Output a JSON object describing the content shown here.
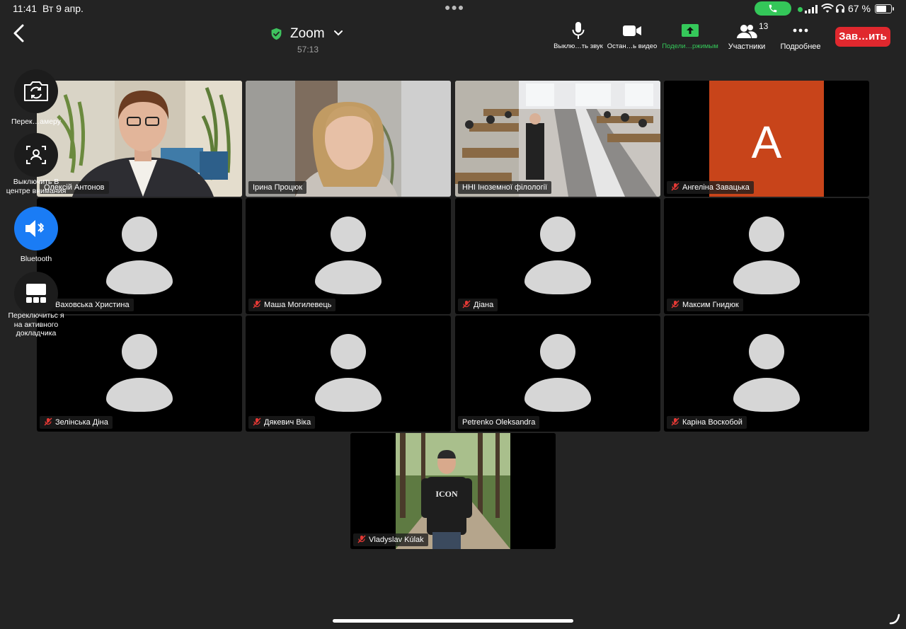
{
  "status_bar": {
    "time": "11:41",
    "date": "Вт 9 апр.",
    "battery_percent": "67 %"
  },
  "meeting": {
    "title": "Zoom",
    "timer": "57:13"
  },
  "toolbar": {
    "mute_label": "Выклю…ть звук",
    "video_label": "Остан…ь видео",
    "share_label": "Подели…ржимым",
    "participants_label": "Участники",
    "participants_count": "13",
    "more_label": "Подробнее",
    "end_label": "Зав…ить"
  },
  "side_controls": [
    {
      "label": "Перек…амеру"
    },
    {
      "label": "Выключить В центре внимания"
    },
    {
      "label": "Bluetooth"
    },
    {
      "label": "Переключитьс я на активного докладчика"
    }
  ],
  "participants": [
    {
      "name": "Олексій Антонов"
    },
    {
      "name": "Ірина Процюк"
    },
    {
      "name": "ННІ Іноземної філології"
    },
    {
      "name": "Ангеліна Завацька",
      "initial": "A"
    },
    {
      "name": "Ваховська Христина"
    },
    {
      "name": "Маша Могилевець"
    },
    {
      "name": "Діана"
    },
    {
      "name": "Максим Гнидюк"
    },
    {
      "name": "Зелінська Діна"
    },
    {
      "name": "Дякевич Віка"
    },
    {
      "name": "Petrenko Oleksandra"
    },
    {
      "name": "Каріна Воскобой"
    },
    {
      "name": "Vladyslav Kúlak",
      "shirt_text": "ICON"
    }
  ],
  "colors": {
    "background": "#232323",
    "active_speaker_border": "#3fd160",
    "end_button": "#e0282e",
    "share_green": "#35c85a",
    "bluetooth_blue": "#1a7cf5",
    "avatar_gray": "#d6d6d6",
    "initial_tile": "#c8441a"
  }
}
